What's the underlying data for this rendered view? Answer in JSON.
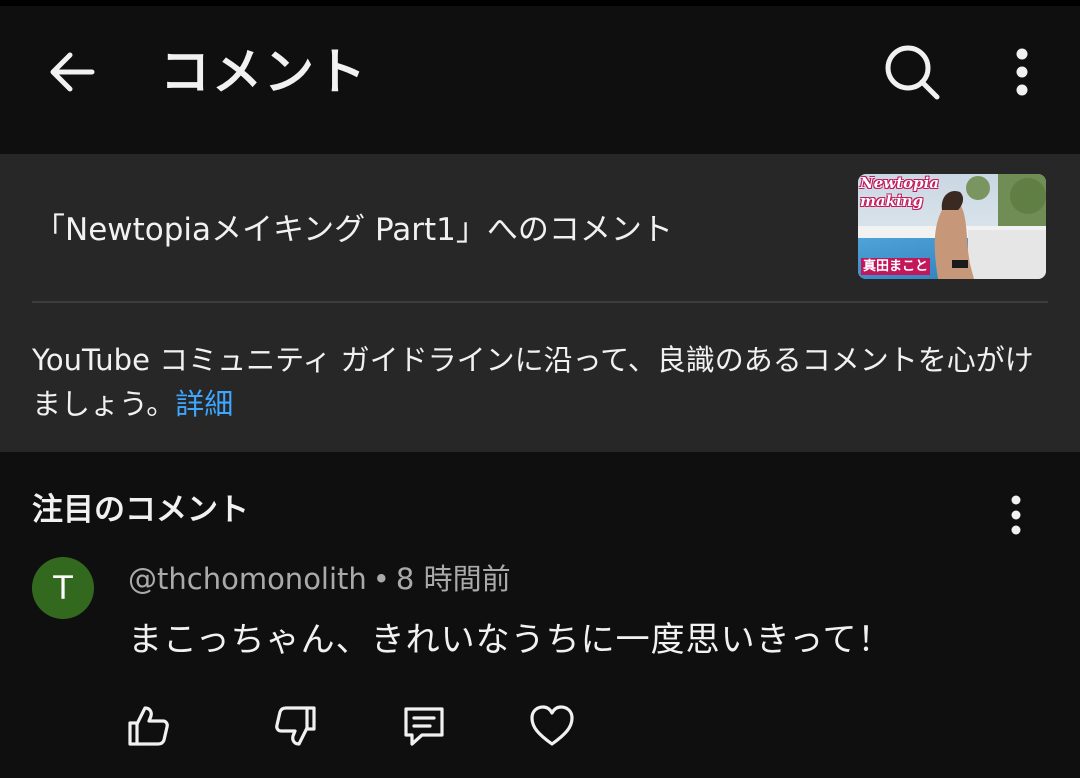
{
  "header": {
    "title": "コメント",
    "back_icon": "arrow-left-icon",
    "search_icon": "search-icon",
    "menu_icon": "more-vertical-icon"
  },
  "video": {
    "heading": "「Newtopiaメイキング Part1」へのコメント",
    "thumbnail": {
      "title_text": "Newtopia making",
      "caption": "真田まこと"
    }
  },
  "guidelines": {
    "text": "YouTube コミュニティ ガイドラインに沿って、良識のあるコメントを心がけましょう。",
    "link_label": "詳細"
  },
  "section": {
    "title": "注目のコメント",
    "menu_icon": "more-vertical-icon"
  },
  "comment": {
    "avatar_letter": "T",
    "avatar_color": "#33691e",
    "author": "@thchomonolith",
    "separator": "•",
    "time": "8 時間前",
    "text": "まこっちゃん、きれいなうちに一度思いきって！",
    "actions": [
      "thumbs-up-icon",
      "thumbs-down-icon",
      "reply-icon",
      "heart-icon"
    ]
  },
  "colors": {
    "background": "#0f0f0f",
    "panel": "#272727",
    "link": "#3ea6ff",
    "secondary_text": "#aaaaaa"
  }
}
